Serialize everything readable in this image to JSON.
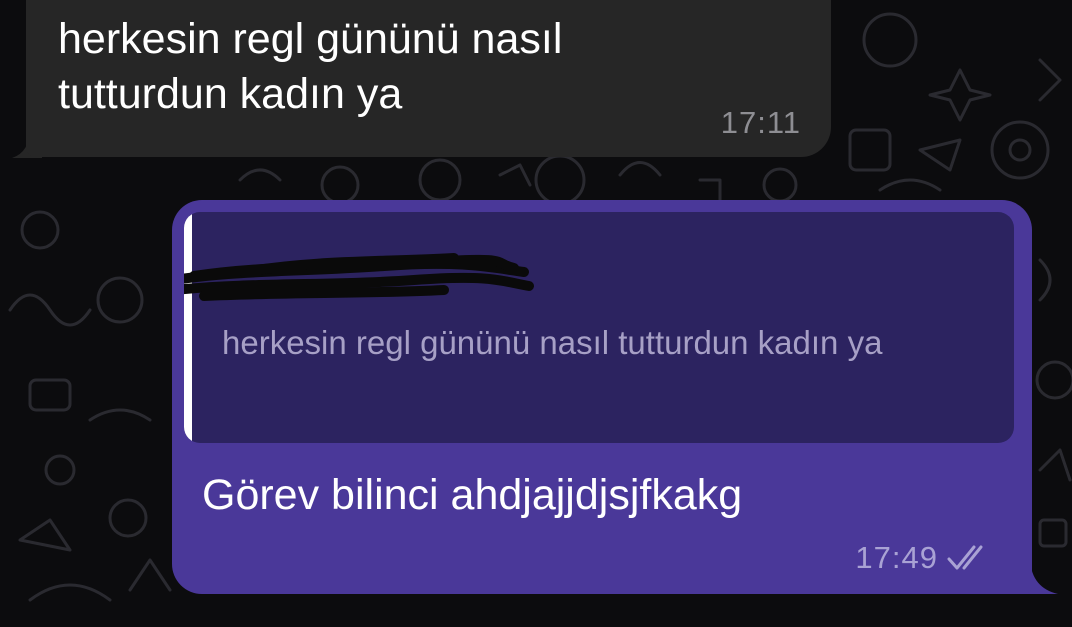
{
  "messages": {
    "incoming": {
      "text": "herkesin regl gününü nasıl tutturdun kadın ya",
      "time": "17:11"
    },
    "outgoing": {
      "reply_quote": {
        "author": "",
        "text": "herkesin regl gününü nasıl tutturdun kadın ya"
      },
      "text": "Görev bilinci ahdjajjdjsjfkakg",
      "time": "17:49",
      "status_icon": "double-check-icon"
    }
  },
  "colors": {
    "background": "#0c0c0e",
    "incoming_bubble": "#262626",
    "outgoing_bubble": "#4a3899",
    "reply_box": "#2c2360",
    "reply_bar": "#ffffff"
  }
}
